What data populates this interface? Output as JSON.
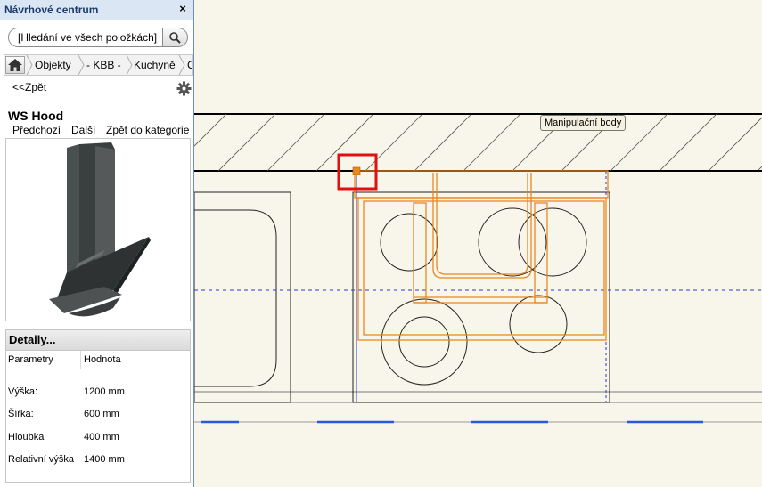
{
  "panel": {
    "title": "Návrhové centrum",
    "close_label": "×",
    "search": {
      "placeholder": "[Hledání ve všech položkách]"
    },
    "breadcrumb": [
      "Objekty",
      "- KBB -",
      "Kuchyně",
      "C"
    ],
    "back_label": "<<Zpět",
    "item": {
      "title": "WS Hood",
      "nav": {
        "prev": "Předchozí",
        "next": "Další",
        "back_to_category": "Zpět do kategorie"
      }
    },
    "details": {
      "title": "Detaily...",
      "col_param": "Parametry",
      "col_value": "Hodnota",
      "params": [
        {
          "name": "Výška:",
          "value": "1200 mm"
        },
        {
          "name": "Šířka:",
          "value": "600 mm"
        },
        {
          "name": "Hloubka",
          "value": "400 mm"
        },
        {
          "name": "Relativní výška",
          "value": "1400 mm"
        }
      ]
    }
  },
  "canvas": {
    "tooltip": "Manipulační body",
    "colors": {
      "background": "#f8f5ea",
      "hood": "#e8891e",
      "selection": "#e01010",
      "guide": "#2c3bc8",
      "dimension": "#2a5ad8"
    }
  }
}
